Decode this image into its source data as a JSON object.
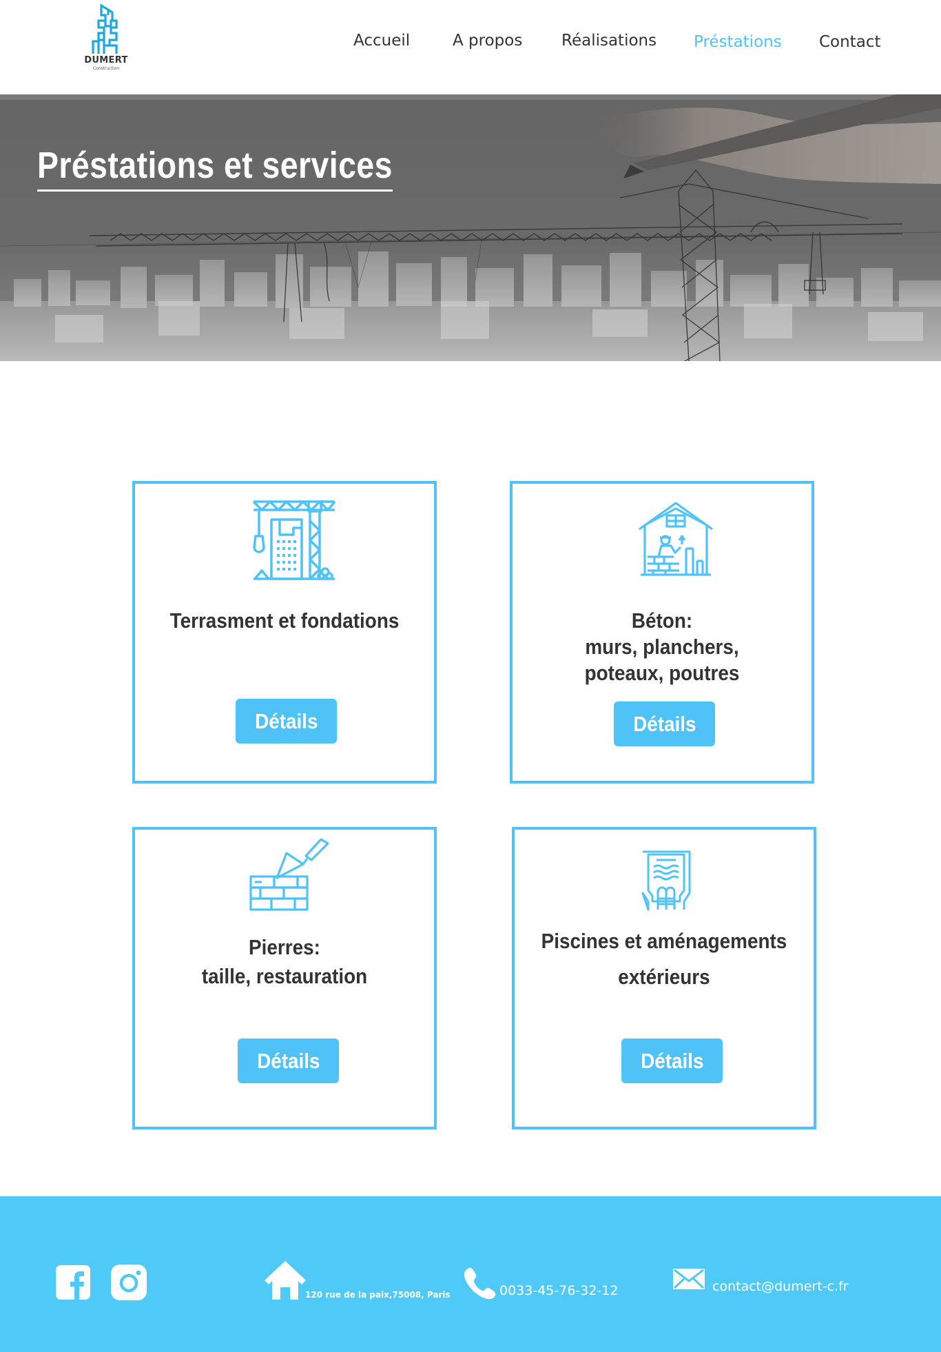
{
  "brand": {
    "name": "DUMERT",
    "tagline": "Construction",
    "accent_color": "#4fc3f7",
    "footer_color": "#4fc9f8"
  },
  "nav": {
    "items": [
      {
        "label": "Accueil",
        "active": false
      },
      {
        "label": "A propos",
        "active": false
      },
      {
        "label": "Réalisations",
        "active": false
      },
      {
        "label": "Préstations",
        "active": true
      },
      {
        "label": "Contact",
        "active": false
      }
    ]
  },
  "hero": {
    "title": "Préstations et services"
  },
  "services": [
    {
      "icon": "crane-building-icon",
      "title_lines": [
        "Terrasment et fondations"
      ],
      "button_label": "Détails"
    },
    {
      "icon": "house-worker-icon",
      "title_lines": [
        "Béton:",
        "murs, planchers,",
        "poteaux, poutres"
      ],
      "button_label": "Détails"
    },
    {
      "icon": "brick-trowel-icon",
      "title_lines": [
        "Pierres:",
        "taille, restauration"
      ],
      "button_label": "Détails"
    },
    {
      "icon": "pool-ladder-icon",
      "title_lines": [
        "Piscines et aménagements",
        "extérieurs"
      ],
      "button_label": "Détails"
    }
  ],
  "footer": {
    "social": [
      {
        "icon": "facebook-icon"
      },
      {
        "icon": "instagram-icon"
      }
    ],
    "address": "120 rue de la paix,75008, Paris",
    "phone": "0033-45-76-32-12",
    "email": "contact@dumert-c.fr"
  }
}
